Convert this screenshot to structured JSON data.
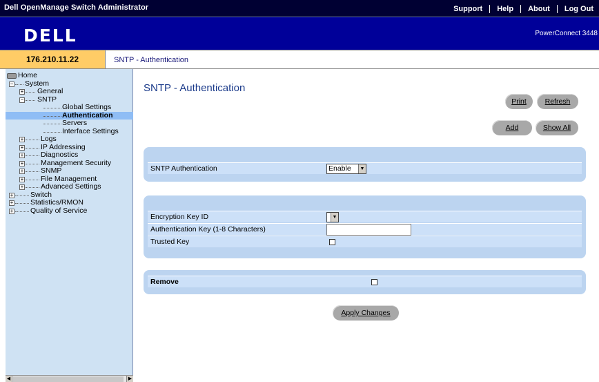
{
  "header": {
    "app_title": "Dell OpenManage Switch Administrator",
    "links": [
      "Support",
      "Help",
      "About",
      "Log Out"
    ],
    "logo": "DELL",
    "product": "PowerConnect 3448"
  },
  "address": {
    "ip": "176.210.11.22",
    "breadcrumb": "SNTP - Authentication"
  },
  "nav": {
    "root": "Home",
    "items": [
      {
        "label": "System",
        "exp": "-"
      },
      {
        "label": "General",
        "exp": "+"
      },
      {
        "label": "SNTP",
        "exp": "-"
      },
      {
        "label": "Global Settings"
      },
      {
        "label": "Authentication",
        "selected": true
      },
      {
        "label": "Servers"
      },
      {
        "label": "Interface Settings"
      },
      {
        "label": "Logs",
        "exp": "+"
      },
      {
        "label": "IP Addressing",
        "exp": "+"
      },
      {
        "label": "Diagnostics",
        "exp": "+"
      },
      {
        "label": "Management Security",
        "exp": "+"
      },
      {
        "label": "SNMP",
        "exp": "+"
      },
      {
        "label": "File Management",
        "exp": "+"
      },
      {
        "label": "Advanced Settings",
        "exp": "+"
      },
      {
        "label": "Switch",
        "exp": "+"
      },
      {
        "label": "Statistics/RMON",
        "exp": "+"
      },
      {
        "label": "Quality of Service",
        "exp": "+"
      }
    ]
  },
  "main": {
    "title": "SNTP - Authentication",
    "buttons": {
      "print": "Print",
      "refresh": "Refresh",
      "add": "Add",
      "show_all": "Show All",
      "apply": "Apply Changes"
    },
    "auth_panel": {
      "label": "SNTP Authentication",
      "value": "Enable"
    },
    "key_panel": {
      "key_id_label": "Encryption Key ID",
      "key_id_value": "",
      "auth_key_label": "Authentication Key (1-8 Characters)",
      "auth_key_value": "",
      "trusted_label": "Trusted Key",
      "trusted_checked": false
    },
    "remove_panel": {
      "label": "Remove",
      "checked": false
    }
  },
  "icons": {
    "expand": "plus-box-icon",
    "collapse": "minus-box-icon",
    "home": "drive-icon",
    "dropdown": "triangle-down-icon"
  },
  "colors": {
    "topbar": "#000033",
    "logo_band": "#000099",
    "ip_box": "#ffcc66",
    "nav_bg": "#cfe2f3",
    "panel": "#bcd4f0",
    "row": "#cce0f8"
  }
}
